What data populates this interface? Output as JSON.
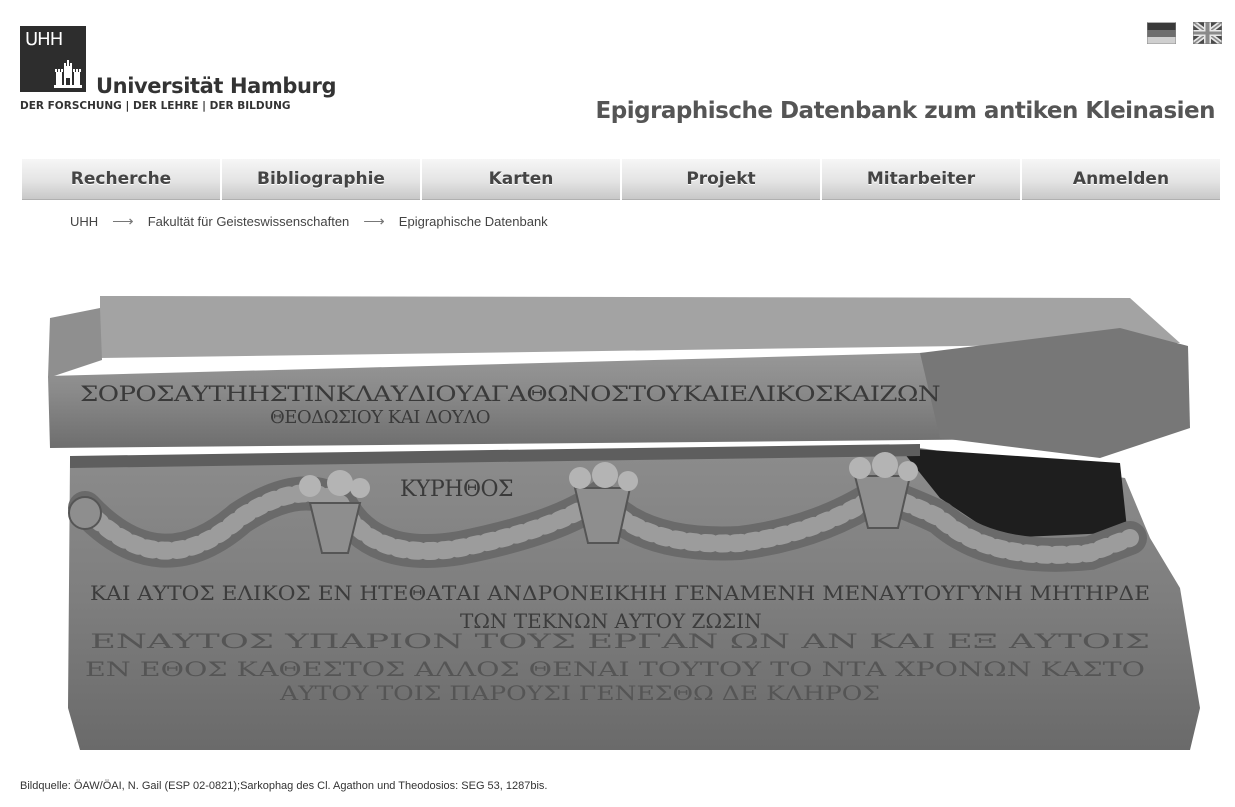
{
  "logo": {
    "mark": "UHH",
    "name": "Universität Hamburg",
    "tagline": "DER FORSCHUNG | DER LEHRE | DER BILDUNG"
  },
  "languages": [
    {
      "code": "de",
      "icon": "german-flag-icon"
    },
    {
      "code": "en",
      "icon": "uk-flag-icon"
    }
  ],
  "site_title": "Epigraphische Datenbank zum antiken Kleinasien",
  "nav": {
    "items": [
      "Recherche",
      "Bibliographie",
      "Karten",
      "Projekt",
      "Mitarbeiter",
      "Anmelden"
    ]
  },
  "breadcrumb": {
    "items": [
      "UHH",
      "Fakultät für Geisteswissenschaften",
      "Epigraphische Datenbank"
    ],
    "separator": "⟶"
  },
  "image": {
    "lid_inscription": "ΣΟΡΟΣΑΥΤΗΗΣΤΙΝΚΛΑΥΔΙΟΥΑΓΑΘΩΝΟΣΤΟΥΚΑΙΕΛΙΚΟΣΚΑΙΖΩΝ",
    "lid_inscription_2": "ΘΕΟΔΩΣΙΟΥ ΚΑΙ ΔΟΥΛΟ",
    "body_lines": [
      "ΚΑΙ ΑΥΤΟΣ ΕΛΙΚΟΣ ΕΝ ΗΤΕΘΑΤΑΙ ΑΝΔΡΟΝΕΙΚΗΗ ΓΕΝΑΜΕΝΗ ΜΕΝΑΥΤΟΥΓΥΝΗ ΜΗΤΗΡΔΕ",
      "ΤΩΝ ΤΕΚΝΩΝ ΑΥΤΟΥ ΖΩΣΙΝ",
      "ΕΝΑΥΤΟΣ ΥΠΑΡΙΟΝ ΤΟΥΣ ΕΡΓΑΝ ΩΝ ΑΝ ΚΑΙ ΕΞ ΑΥΤΟΙΣ",
      "ΕΝ ΕΘΟΣ ΚΑΘΕΣΤΟΣ ΑΛΛΟΣ ΘΕΝΑΙ ΤΟΥΤΟΥ ΤΟ ΝΤΑ ΧΡΟΝΩΝ ΚΑΣΤΟ",
      "ΑΥΤΟΥ ΤΟΙΣ ΠΑΡΟΥΣΙ ΓΕΝΕΣΘΩ ΔΕ ΚΛΗΡΟΣ"
    ],
    "garland_text": "ΚΥΡΗΘΟΣ",
    "color": "#7a7a7a"
  },
  "caption": "Bildquelle: ÖAW/ÖAI, N. Gail (ESP 02-0821);Sarkophag des Cl. Agathon und Theodosios: SEG 53, 1287bis."
}
